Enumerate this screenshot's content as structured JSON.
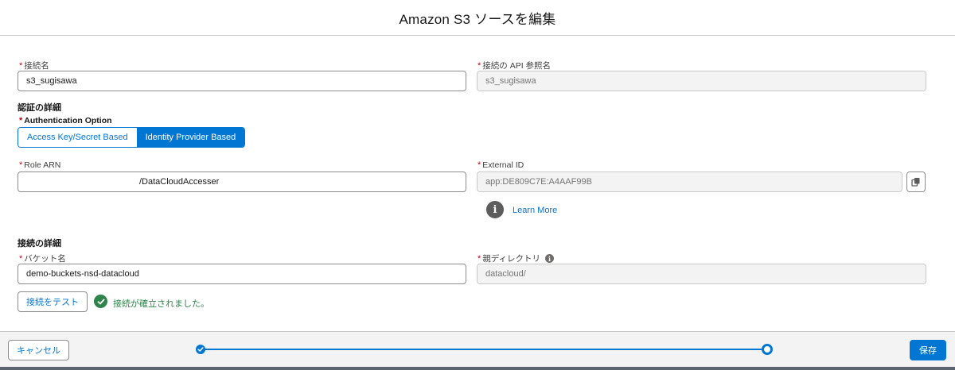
{
  "header": {
    "title": "Amazon S3 ソースを編集"
  },
  "connection": {
    "name_label": "接続名",
    "name_value": "s3_sugisawa",
    "api_label": "接続の API 参照名",
    "api_value": "s3_sugisawa"
  },
  "auth": {
    "section_title": "認証の詳細",
    "option_label": "Authentication Option",
    "options": [
      "Access Key/Secret Based",
      "Identity Provider Based"
    ],
    "selected_option": "Identity Provider Based",
    "role_arn_label": "Role ARN",
    "role_arn_value": "/DataCloudAccesser",
    "external_id_label": "External ID",
    "external_id_value": "app:DE809C7E:A4AAF99B",
    "learn_more": "Learn More"
  },
  "details": {
    "section_title": "接続の詳細",
    "bucket_label": "バケット名",
    "bucket_value": "demo-buckets-nsd-datacloud",
    "parent_dir_label": "親ディレクトリ",
    "parent_dir_value": "datacloud/",
    "test_button": "接続をテスト",
    "success_message": "接続が確立されました。"
  },
  "footer": {
    "cancel_label": "キャンセル",
    "save_label": "保存",
    "progress_steps": 2,
    "current_step": 2
  },
  "colors": {
    "brand": "#0176d3",
    "success": "#2e844a",
    "required": "#ba0517"
  }
}
